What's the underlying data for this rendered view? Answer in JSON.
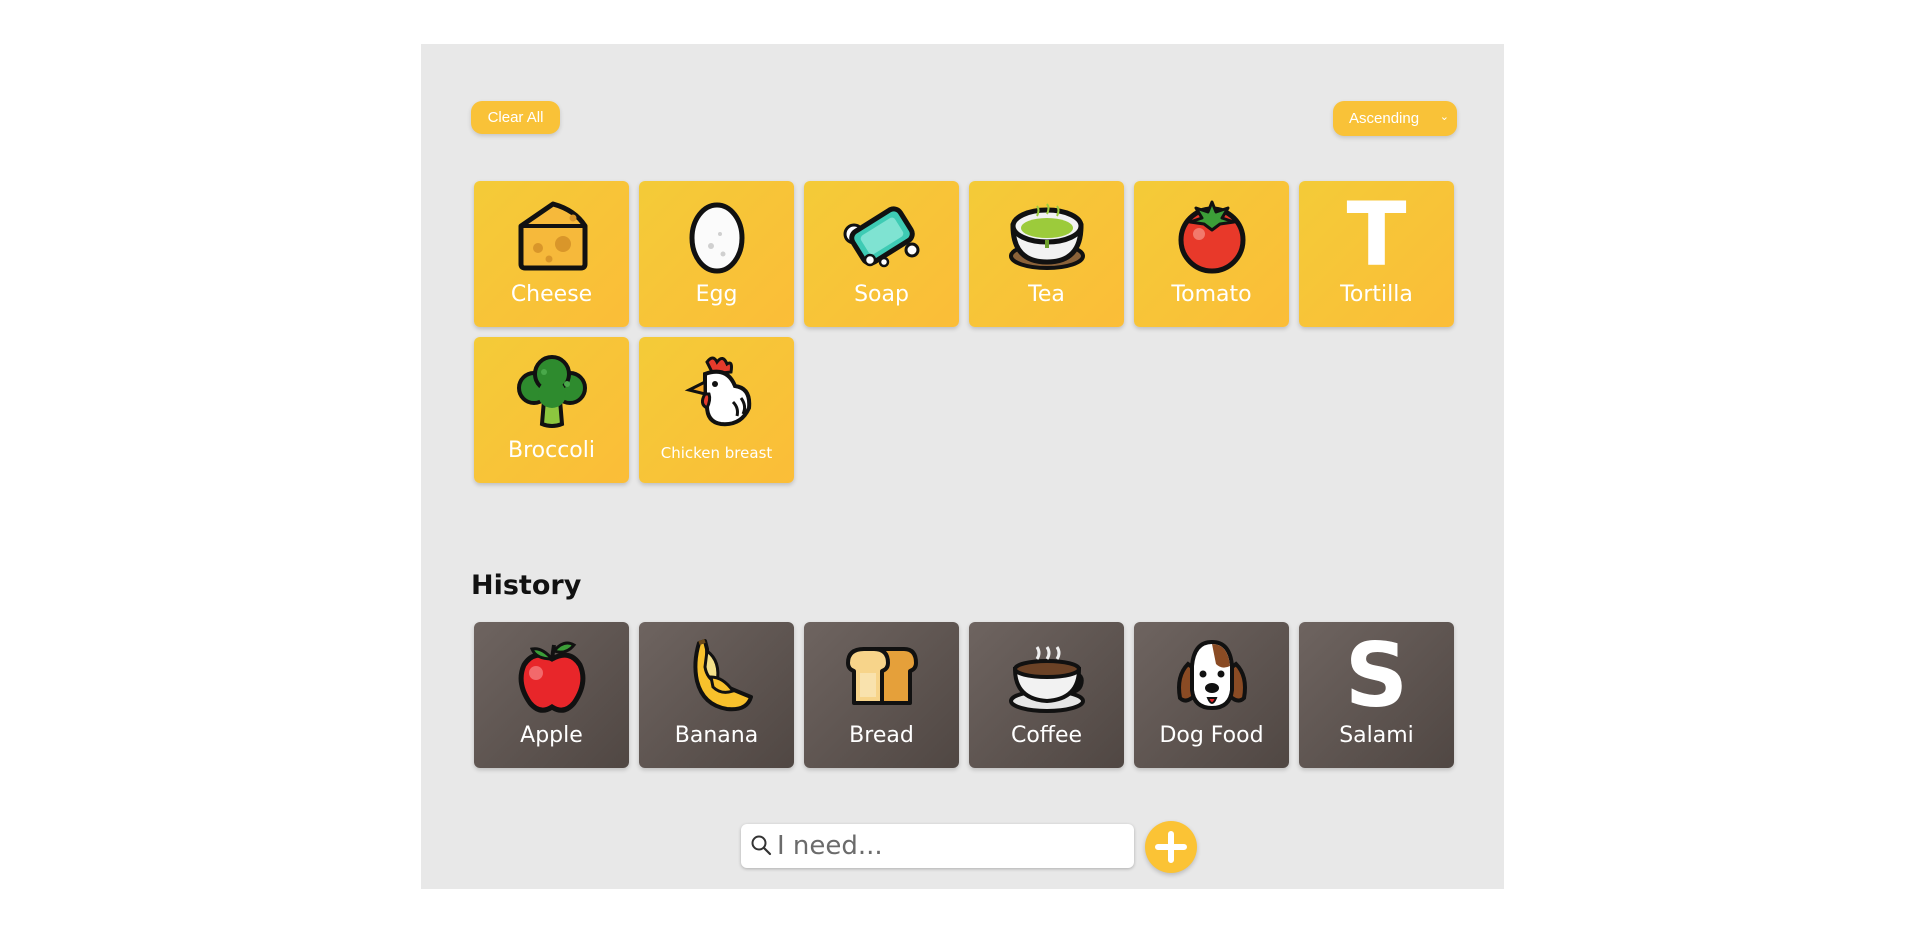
{
  "toolbar": {
    "clear_label": "Clear All",
    "sort_selected": "Ascending"
  },
  "active_items": [
    {
      "label": "Cheese",
      "icon": "cheese-icon"
    },
    {
      "label": "Egg",
      "icon": "egg-icon"
    },
    {
      "label": "Soap",
      "icon": "soap-icon"
    },
    {
      "label": "Tea",
      "icon": "tea-icon"
    },
    {
      "label": "Tomato",
      "icon": "tomato-icon"
    },
    {
      "label": "Tortilla",
      "icon": "letter-t-icon",
      "letter": "T"
    },
    {
      "label": "Broccoli",
      "icon": "broccoli-icon"
    },
    {
      "label": "Chicken breast",
      "icon": "chicken-icon"
    }
  ],
  "history": {
    "title": "History",
    "items": [
      {
        "label": "Apple",
        "icon": "apple-icon"
      },
      {
        "label": "Banana",
        "icon": "banana-icon"
      },
      {
        "label": "Bread",
        "icon": "bread-icon"
      },
      {
        "label": "Coffee",
        "icon": "coffee-icon"
      },
      {
        "label": "Dog Food",
        "icon": "dog-icon"
      },
      {
        "label": "Salami",
        "icon": "letter-s-icon",
        "letter": "S"
      }
    ]
  },
  "search": {
    "placeholder": "I need...",
    "value": ""
  },
  "colors": {
    "accent": "#f9c238",
    "history_tile": "#5f5551",
    "panel_bg": "#e8e8e8"
  }
}
